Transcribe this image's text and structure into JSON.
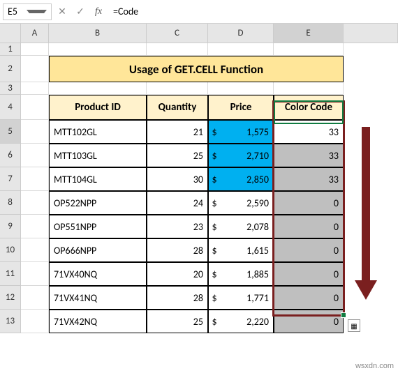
{
  "name_box": "E5",
  "formula": "=Code",
  "buttons": {
    "cancel": "✕",
    "confirm": "✓",
    "fx": "fx"
  },
  "cols": [
    "A",
    "B",
    "C",
    "D",
    "E"
  ],
  "rows": [
    "1",
    "2",
    "3",
    "4",
    "5",
    "6",
    "7",
    "8",
    "9",
    "10",
    "11",
    "12",
    "13"
  ],
  "title": "Usage of GET.CELL Function",
  "headers": {
    "product": "Product ID",
    "qty": "Quantity",
    "price": "Price",
    "color": "Color Code"
  },
  "data": [
    {
      "product": "MTT102GL",
      "qty": "21",
      "price": "1,575",
      "blue": true,
      "code": "33",
      "grey": false
    },
    {
      "product": "MTT103GL",
      "qty": "25",
      "price": "2,710",
      "blue": true,
      "code": "33",
      "grey": true
    },
    {
      "product": "MTT104GL",
      "qty": "30",
      "price": "2,850",
      "blue": true,
      "code": "33",
      "grey": true
    },
    {
      "product": "OP522NPP",
      "qty": "24",
      "price": "2,590",
      "blue": false,
      "code": "0",
      "grey": true
    },
    {
      "product": "OP551NPP",
      "qty": "23",
      "price": "2,078",
      "blue": false,
      "code": "0",
      "grey": true
    },
    {
      "product": "OP666NPP",
      "qty": "28",
      "price": "1,615",
      "blue": false,
      "code": "0",
      "grey": true
    },
    {
      "product": "71VX40NQ",
      "qty": "20",
      "price": "1,885",
      "blue": false,
      "code": "0",
      "grey": true
    },
    {
      "product": "71VX41NQ",
      "qty": "28",
      "price": "1,771",
      "blue": false,
      "code": "0",
      "grey": true
    },
    {
      "product": "71VX42NQ",
      "qty": "25",
      "price": "2,220",
      "blue": false,
      "code": "0",
      "grey": true
    }
  ],
  "currency": "$",
  "watermark": "wsxdn.com",
  "colwidths": {
    "a": 40,
    "b": 140,
    "c": 88,
    "d": 94,
    "e": 100
  },
  "rowheights": {
    "r1": 18,
    "r2": 38,
    "r3": 18,
    "r4": 36,
    "data": 34
  }
}
